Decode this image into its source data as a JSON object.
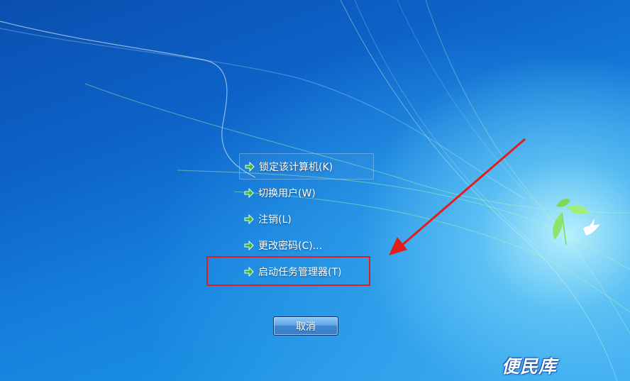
{
  "menu": {
    "items": [
      {
        "label": "锁定该计算机(K)"
      },
      {
        "label": "切换用户(W)"
      },
      {
        "label": "注销(L)"
      },
      {
        "label": "更改密码(C)..."
      },
      {
        "label": "启动任务管理器(T)"
      }
    ]
  },
  "cancel_button": {
    "label": "取消"
  },
  "watermark": {
    "text": "便民库"
  },
  "colors": {
    "annotation_red": "#e31c1c",
    "menu_arrow_green": "#3fb83a",
    "button_blue": "#4a90d9"
  },
  "icons": {
    "menu_item_icon": "green-arrow-icon",
    "annotation_pointer": "red-arrow-icon"
  }
}
